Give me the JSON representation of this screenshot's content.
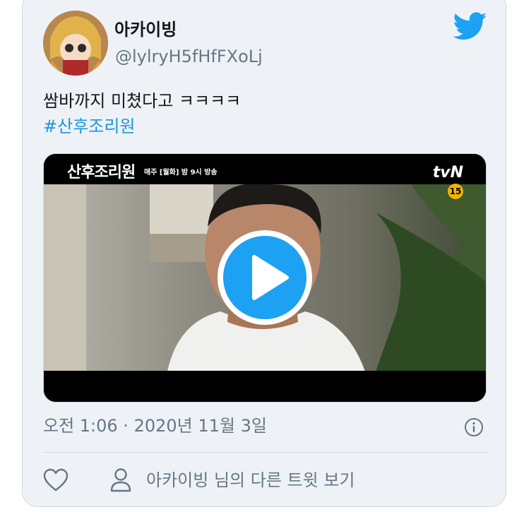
{
  "tweet": {
    "display_name": "아카이빙",
    "handle": "@lylryH5fHfFXoLj",
    "text": "쌈바까지 미쳤다고 ㅋㅋㅋㅋ",
    "hashtag": "#산후조리원",
    "timestamp": "오전 1:06 · 2020년 11월 3일"
  },
  "media": {
    "show_title": "산후조리원",
    "schedule": "매주 [월화] 밤 9시 방송",
    "channel": "tvN",
    "rating": "15"
  },
  "actions": {
    "profile_link_label": "아카이빙 님의 다른 트윗 보기"
  },
  "icons": {
    "brand": "twitter-bird-icon",
    "play": "play-icon",
    "info": "info-icon",
    "like": "heart-icon",
    "profile": "person-icon"
  },
  "colors": {
    "card_background": "#eef2f6",
    "brand_blue": "#1da1f2",
    "link_blue": "#1b95e0",
    "secondary_text": "#657786",
    "primary_text": "#14171a"
  }
}
